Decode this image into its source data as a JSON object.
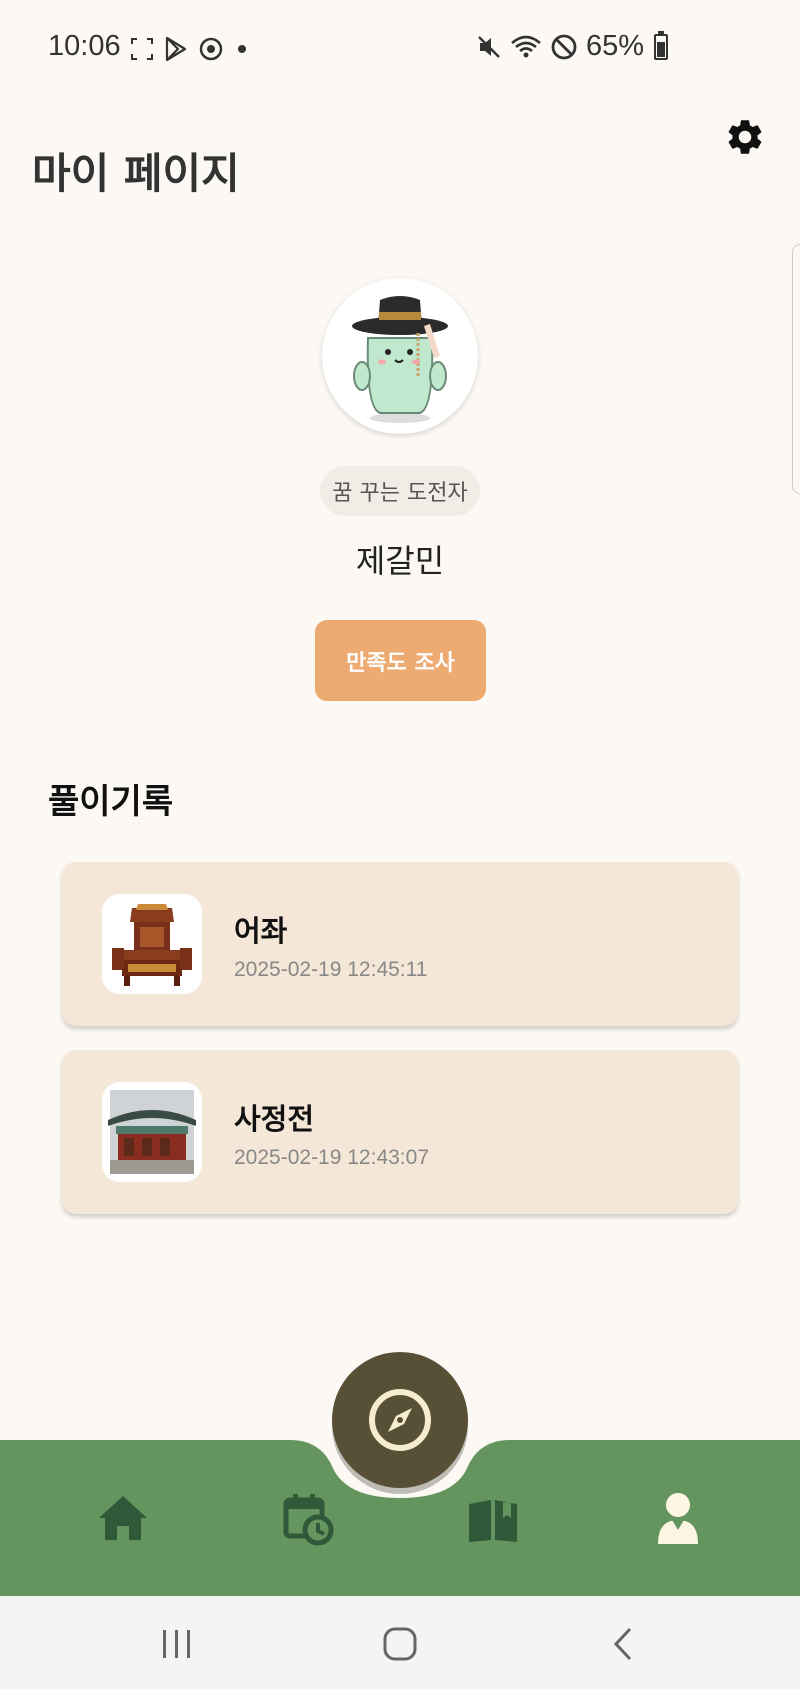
{
  "status_bar": {
    "time": "10:06",
    "battery_percent": "65%",
    "icons": [
      "screenshot-icon",
      "play-store-icon",
      "media-icon",
      "dot-icon",
      "mute-icon",
      "wifi-icon",
      "do-not-disturb-icon",
      "battery-icon"
    ]
  },
  "header": {
    "title": "마이 페이지",
    "settings_icon": "gear-icon"
  },
  "profile": {
    "badge": "꿈 꾸는 도전자",
    "name": "제갈민",
    "survey_button": "만족도 조사"
  },
  "records": {
    "section_title": "풀이기록",
    "items": [
      {
        "title": "어좌",
        "date": "2025-02-19 12:45:11",
        "thumb": "throne-image"
      },
      {
        "title": "사정전",
        "date": "2025-02-19 12:43:07",
        "thumb": "palace-image"
      }
    ]
  },
  "bottom_nav": {
    "items": [
      "home-icon",
      "calendar-clock-icon",
      "compass-icon",
      "book-icon",
      "profile-icon"
    ],
    "active": "profile-icon",
    "colors": {
      "bar": "#65955e",
      "inactive": "#2f5a3a",
      "active": "#fdf6e3",
      "fab": "#585036"
    }
  },
  "system_nav": [
    "recents-icon",
    "home-circle-icon",
    "back-icon"
  ]
}
